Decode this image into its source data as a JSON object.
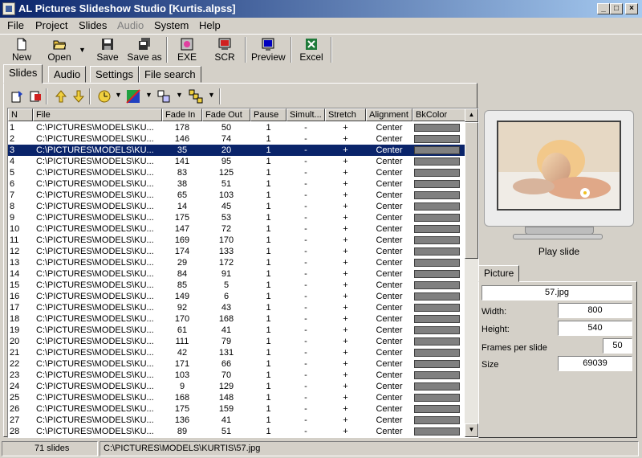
{
  "window": {
    "title": "AL Pictures Slideshow Studio [Kurtis.alpss]",
    "minimize": "_",
    "maximize": "□",
    "close": "×"
  },
  "menu": [
    "File",
    "Project",
    "Slides",
    "Audio",
    "System",
    "Help"
  ],
  "menu_disabled": [
    "Audio"
  ],
  "toolbar": {
    "new": "New",
    "open": "Open",
    "save": "Save",
    "save_as": "Save as",
    "exe": "EXE",
    "scr": "SCR",
    "preview": "Preview",
    "excel": "Excel"
  },
  "tabs": [
    "Slides",
    "Audio",
    "Settings",
    "File search"
  ],
  "active_tab": "Slides",
  "columns": [
    "N",
    "File",
    "Fade In",
    "Fade Out",
    "Pause",
    "Simult...",
    "Stretch",
    "Alignment",
    "BkColor"
  ],
  "rows": [
    {
      "n": "1",
      "file": "C:\\PICTURES\\MODELS\\KU...",
      "fade_in": "178",
      "fade_out": "50",
      "pause": "1",
      "simult": "-",
      "stretch": "+",
      "align": "Center"
    },
    {
      "n": "2",
      "file": "C:\\PICTURES\\MODELS\\KU...",
      "fade_in": "146",
      "fade_out": "74",
      "pause": "1",
      "simult": "-",
      "stretch": "+",
      "align": "Center"
    },
    {
      "n": "3",
      "file": "C:\\PICTURES\\MODELS\\KU...",
      "fade_in": "35",
      "fade_out": "20",
      "pause": "1",
      "simult": "-",
      "stretch": "+",
      "align": "Center"
    },
    {
      "n": "4",
      "file": "C:\\PICTURES\\MODELS\\KU...",
      "fade_in": "141",
      "fade_out": "95",
      "pause": "1",
      "simult": "-",
      "stretch": "+",
      "align": "Center"
    },
    {
      "n": "5",
      "file": "C:\\PICTURES\\MODELS\\KU...",
      "fade_in": "83",
      "fade_out": "125",
      "pause": "1",
      "simult": "-",
      "stretch": "+",
      "align": "Center"
    },
    {
      "n": "6",
      "file": "C:\\PICTURES\\MODELS\\KU...",
      "fade_in": "38",
      "fade_out": "51",
      "pause": "1",
      "simult": "-",
      "stretch": "+",
      "align": "Center"
    },
    {
      "n": "7",
      "file": "C:\\PICTURES\\MODELS\\KU...",
      "fade_in": "65",
      "fade_out": "103",
      "pause": "1",
      "simult": "-",
      "stretch": "+",
      "align": "Center"
    },
    {
      "n": "8",
      "file": "C:\\PICTURES\\MODELS\\KU...",
      "fade_in": "14",
      "fade_out": "45",
      "pause": "1",
      "simult": "-",
      "stretch": "+",
      "align": "Center"
    },
    {
      "n": "9",
      "file": "C:\\PICTURES\\MODELS\\KU...",
      "fade_in": "175",
      "fade_out": "53",
      "pause": "1",
      "simult": "-",
      "stretch": "+",
      "align": "Center"
    },
    {
      "n": "10",
      "file": "C:\\PICTURES\\MODELS\\KU...",
      "fade_in": "147",
      "fade_out": "72",
      "pause": "1",
      "simult": "-",
      "stretch": "+",
      "align": "Center"
    },
    {
      "n": "11",
      "file": "C:\\PICTURES\\MODELS\\KU...",
      "fade_in": "169",
      "fade_out": "170",
      "pause": "1",
      "simult": "-",
      "stretch": "+",
      "align": "Center"
    },
    {
      "n": "12",
      "file": "C:\\PICTURES\\MODELS\\KU...",
      "fade_in": "174",
      "fade_out": "133",
      "pause": "1",
      "simult": "-",
      "stretch": "+",
      "align": "Center"
    },
    {
      "n": "13",
      "file": "C:\\PICTURES\\MODELS\\KU...",
      "fade_in": "29",
      "fade_out": "172",
      "pause": "1",
      "simult": "-",
      "stretch": "+",
      "align": "Center"
    },
    {
      "n": "14",
      "file": "C:\\PICTURES\\MODELS\\KU...",
      "fade_in": "84",
      "fade_out": "91",
      "pause": "1",
      "simult": "-",
      "stretch": "+",
      "align": "Center"
    },
    {
      "n": "15",
      "file": "C:\\PICTURES\\MODELS\\KU...",
      "fade_in": "85",
      "fade_out": "5",
      "pause": "1",
      "simult": "-",
      "stretch": "+",
      "align": "Center"
    },
    {
      "n": "16",
      "file": "C:\\PICTURES\\MODELS\\KU...",
      "fade_in": "149",
      "fade_out": "6",
      "pause": "1",
      "simult": "-",
      "stretch": "+",
      "align": "Center"
    },
    {
      "n": "17",
      "file": "C:\\PICTURES\\MODELS\\KU...",
      "fade_in": "92",
      "fade_out": "43",
      "pause": "1",
      "simult": "-",
      "stretch": "+",
      "align": "Center"
    },
    {
      "n": "18",
      "file": "C:\\PICTURES\\MODELS\\KU...",
      "fade_in": "170",
      "fade_out": "168",
      "pause": "1",
      "simult": "-",
      "stretch": "+",
      "align": "Center"
    },
    {
      "n": "19",
      "file": "C:\\PICTURES\\MODELS\\KU...",
      "fade_in": "61",
      "fade_out": "41",
      "pause": "1",
      "simult": "-",
      "stretch": "+",
      "align": "Center"
    },
    {
      "n": "20",
      "file": "C:\\PICTURES\\MODELS\\KU...",
      "fade_in": "111",
      "fade_out": "79",
      "pause": "1",
      "simult": "-",
      "stretch": "+",
      "align": "Center"
    },
    {
      "n": "21",
      "file": "C:\\PICTURES\\MODELS\\KU...",
      "fade_in": "42",
      "fade_out": "131",
      "pause": "1",
      "simult": "-",
      "stretch": "+",
      "align": "Center"
    },
    {
      "n": "22",
      "file": "C:\\PICTURES\\MODELS\\KU...",
      "fade_in": "171",
      "fade_out": "66",
      "pause": "1",
      "simult": "-",
      "stretch": "+",
      "align": "Center"
    },
    {
      "n": "23",
      "file": "C:\\PICTURES\\MODELS\\KU...",
      "fade_in": "103",
      "fade_out": "70",
      "pause": "1",
      "simult": "-",
      "stretch": "+",
      "align": "Center"
    },
    {
      "n": "24",
      "file": "C:\\PICTURES\\MODELS\\KU...",
      "fade_in": "9",
      "fade_out": "129",
      "pause": "1",
      "simult": "-",
      "stretch": "+",
      "align": "Center"
    },
    {
      "n": "25",
      "file": "C:\\PICTURES\\MODELS\\KU...",
      "fade_in": "168",
      "fade_out": "148",
      "pause": "1",
      "simult": "-",
      "stretch": "+",
      "align": "Center"
    },
    {
      "n": "26",
      "file": "C:\\PICTURES\\MODELS\\KU...",
      "fade_in": "175",
      "fade_out": "159",
      "pause": "1",
      "simult": "-",
      "stretch": "+",
      "align": "Center"
    },
    {
      "n": "27",
      "file": "C:\\PICTURES\\MODELS\\KU...",
      "fade_in": "136",
      "fade_out": "41",
      "pause": "1",
      "simult": "-",
      "stretch": "+",
      "align": "Center"
    },
    {
      "n": "28",
      "file": "C:\\PICTURES\\MODELS\\KU...",
      "fade_in": "89",
      "fade_out": "51",
      "pause": "1",
      "simult": "-",
      "stretch": "+",
      "align": "Center"
    }
  ],
  "selected_row": "3",
  "colors": {
    "title_start": "#0a246a",
    "title_end": "#a6caf0",
    "selection": "#0a246a",
    "bkcolor_swatch": "#808080",
    "face": "#d4d0c8"
  },
  "preview": {
    "play_label": "Play slide"
  },
  "picture": {
    "tab": "Picture",
    "filename": "57.jpg",
    "width_label": "Width:",
    "width": "800",
    "height_label": "Height:",
    "height": "540",
    "fps_label": "Frames per slide",
    "fps": "50",
    "size_label": "Size",
    "size": "69039"
  },
  "status": {
    "count": "71 slides",
    "path": "C:\\PICTURES\\MODELS\\KURTIS\\57.jpg"
  }
}
